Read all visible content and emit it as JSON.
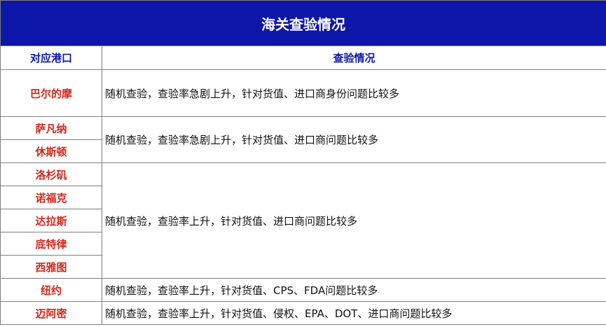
{
  "title": "海关查验情况",
  "headers": {
    "port": "对应港口",
    "status": "查验情况"
  },
  "ports": [
    "巴尔的摩",
    "萨凡纳",
    "休斯顿",
    "洛杉矶",
    "诺福克",
    "达拉斯",
    "底特律",
    "西雅图",
    "纽约",
    "迈阿密"
  ],
  "descriptions": [
    "随机查验，查验率急剧上升，针对货值、进口商身份问题比较多",
    "随机查验，查验率急剧上升，针对货值、进口商问题比较多",
    "随机查验，查验率上升，针对货值、进口商问题比较多",
    "随机查验，查验率上升，针对货值、CPS、FDA问题比较多",
    "随机查验，查验率上升，针对货值、侵权、EPA、DOT、进口商问题比较多"
  ],
  "colors": {
    "title_bg": "#0c16a8",
    "header_text": "#0c16a8",
    "port_text": "#d0281e"
  }
}
